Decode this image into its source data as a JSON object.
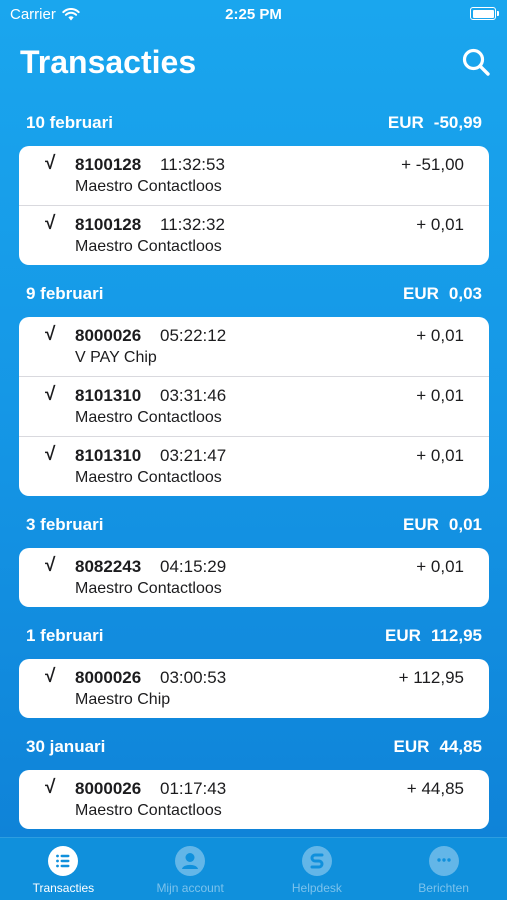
{
  "status_bar": {
    "carrier": "Carrier",
    "time": "2:25 PM",
    "battery_level": 0.9
  },
  "header": {
    "title": "Transacties"
  },
  "days": [
    {
      "date": "10 februari",
      "currency": "EUR",
      "total": "-50,99",
      "transactions": [
        {
          "id": "8100128",
          "time": "11:32:53",
          "amount": "+ -51,00",
          "method": "Maestro Contactloos"
        },
        {
          "id": "8100128",
          "time": "11:32:32",
          "amount": "+ 0,01",
          "method": "Maestro Contactloos"
        }
      ]
    },
    {
      "date": "9 februari",
      "currency": "EUR",
      "total": "0,03",
      "transactions": [
        {
          "id": "8000026",
          "time": "05:22:12",
          "amount": "+ 0,01",
          "method": "V PAY Chip"
        },
        {
          "id": "8101310",
          "time": "03:31:46",
          "amount": "+ 0,01",
          "method": "Maestro Contactloos"
        },
        {
          "id": "8101310",
          "time": "03:21:47",
          "amount": "+ 0,01",
          "method": "Maestro Contactloos"
        }
      ]
    },
    {
      "date": "3 februari",
      "currency": "EUR",
      "total": "0,01",
      "transactions": [
        {
          "id": "8082243",
          "time": "04:15:29",
          "amount": "+ 0,01",
          "method": "Maestro Contactloos"
        }
      ]
    },
    {
      "date": "1 februari",
      "currency": "EUR",
      "total": "112,95",
      "transactions": [
        {
          "id": "8000026",
          "time": "03:00:53",
          "amount": "+ 112,95",
          "method": "Maestro Chip"
        }
      ]
    },
    {
      "date": "30 januari",
      "currency": "EUR",
      "total": "44,85",
      "transactions": [
        {
          "id": "8000026",
          "time": "01:17:43",
          "amount": "+ 44,85",
          "method": "Maestro Contactloos"
        }
      ]
    }
  ],
  "check_glyph": "√",
  "tab_bar": {
    "tabs": [
      {
        "label": "Transacties",
        "icon": "list-icon",
        "active": true
      },
      {
        "label": "Mijn account",
        "icon": "person-icon",
        "active": false
      },
      {
        "label": "Helpdesk",
        "icon": "s-logo-icon",
        "active": false
      },
      {
        "label": "Berichten",
        "icon": "chat-bubble-icon",
        "active": false
      }
    ]
  },
  "colors": {
    "background": "#1597e6",
    "tab_bar": "#1090dc",
    "card": "#ffffff",
    "text_dark": "#1c1c1e"
  }
}
